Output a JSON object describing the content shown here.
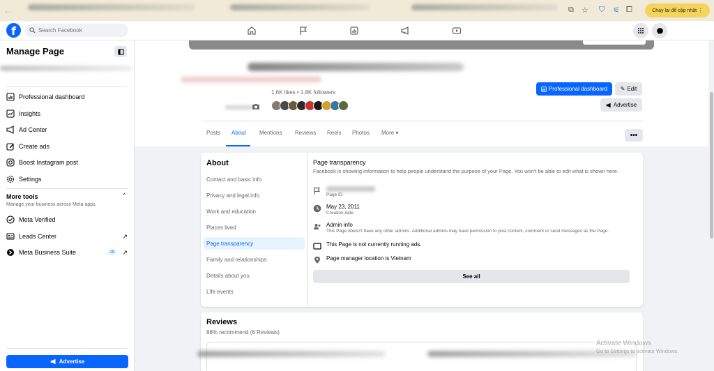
{
  "browser": {
    "update_button": "Chạy lại để cập nhật"
  },
  "topnav": {
    "logo": "f",
    "search_placeholder": "Search Facebook"
  },
  "sidebar": {
    "title": "Manage Page",
    "items": [
      {
        "label": "Professional dashboard",
        "icon": "dashboard-icon"
      },
      {
        "label": "Insights",
        "icon": "insights-icon"
      },
      {
        "label": "Ad Center",
        "icon": "megaphone-icon"
      },
      {
        "label": "Create ads",
        "icon": "edit-icon"
      },
      {
        "label": "Boost Instagram post",
        "icon": "instagram-icon"
      },
      {
        "label": "Settings",
        "icon": "gear-icon"
      }
    ],
    "more_tools": {
      "title": "More tools",
      "subtitle": "Manage your business across Meta apps."
    },
    "tools": [
      {
        "label": "Meta Verified",
        "icon": "verified-icon"
      },
      {
        "label": "Leads Center",
        "icon": "leads-icon",
        "arrow": "↗"
      },
      {
        "label": "Meta Business Suite",
        "icon": "business-suite-icon",
        "badge": "19",
        "arrow": "↗"
      }
    ],
    "advertise_label": "Advertise"
  },
  "page_header": {
    "stats": "1.6K likes • 1.8K followers",
    "professional_dashboard_label": "Professional dashboard",
    "edit_label": "Edit",
    "advertise_label": "Advertise",
    "tabs": [
      {
        "label": "Posts"
      },
      {
        "label": "About"
      },
      {
        "label": "Mentions"
      },
      {
        "label": "Reviews"
      },
      {
        "label": "Reels"
      },
      {
        "label": "Photos"
      },
      {
        "label": "More ▾"
      }
    ],
    "more_dots": "•••"
  },
  "about": {
    "title": "About",
    "items": [
      "Contact and basic info",
      "Privacy and legal info",
      "Work and education",
      "Places lived",
      "Page transparency",
      "Family and relationships",
      "Details about you",
      "Life events"
    ],
    "active_index": 4,
    "transparency": {
      "title": "Page transparency",
      "description": "Facebook is showing information to help people understand the purpose of your Page. You won't be able to edit what is shown here.",
      "page_id_label": "Page ID",
      "creation_date": "May 23, 2011",
      "creation_date_label": "Creation date",
      "admin_info": "Admin info",
      "admin_info_desc": "This Page doesn't have any other admins. Additional admins may have permission to post content, comment or send messages as the Page.",
      "ads_status": "This Page is not currently running ads.",
      "location": "Page manager location is Vietnam",
      "see_all": "See all"
    }
  },
  "reviews": {
    "title": "Reviews",
    "summary": "88% recommend (6 Reviews)"
  },
  "watermark": {
    "line1": "Activate Windows",
    "line2": "Go to Settings to activate Windows."
  },
  "colors": {
    "accent": "#0866ff",
    "bg": "#f0f2f5"
  }
}
